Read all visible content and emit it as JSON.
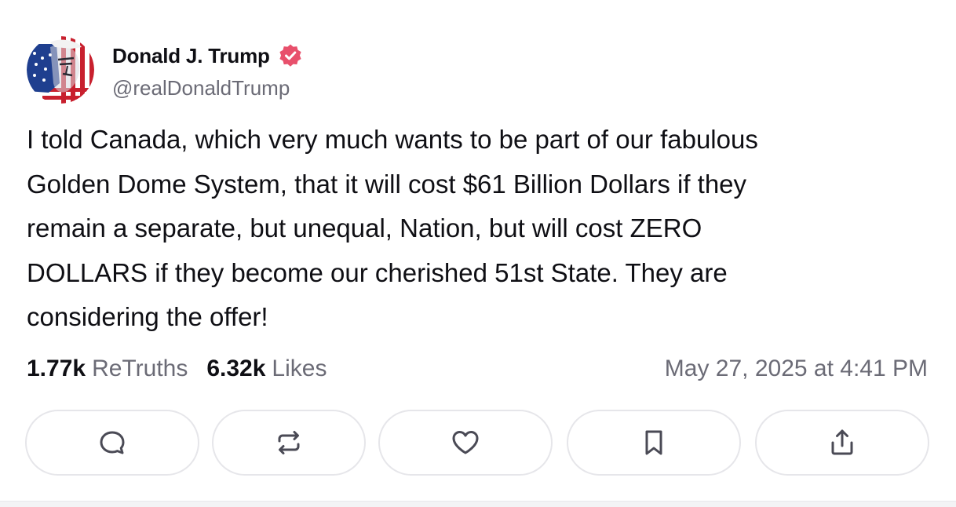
{
  "post": {
    "display_name": "Donald J. Trump",
    "handle": "@realDonaldTrump",
    "verified_color": "#e8506c",
    "avatar_icon": "flag-portrait-avatar",
    "body_lines": [
      "I told Canada, which very much wants to be part of our fabulous",
      "Golden Dome System, that it will cost $61 Billion Dollars if they",
      "remain a separate, but unequal, Nation, but will cost ZERO",
      "DOLLARS if they become our cherished 51st State. They are",
      "considering the offer!"
    ],
    "stats": {
      "retruths_count": "1.77k",
      "retruths_label": "ReTruths",
      "likes_count": "6.32k",
      "likes_label": "Likes"
    },
    "timestamp": "May 27, 2025 at 4:41 PM"
  },
  "actions": [
    {
      "icon": "reply-icon"
    },
    {
      "icon": "retruth-icon"
    },
    {
      "icon": "like-icon"
    },
    {
      "icon": "bookmark-icon"
    },
    {
      "icon": "share-icon"
    }
  ],
  "colors": {
    "text": "#0f0f14",
    "muted": "#6b6b76",
    "border": "#e6e6ea",
    "icon": "#4a4a55"
  }
}
